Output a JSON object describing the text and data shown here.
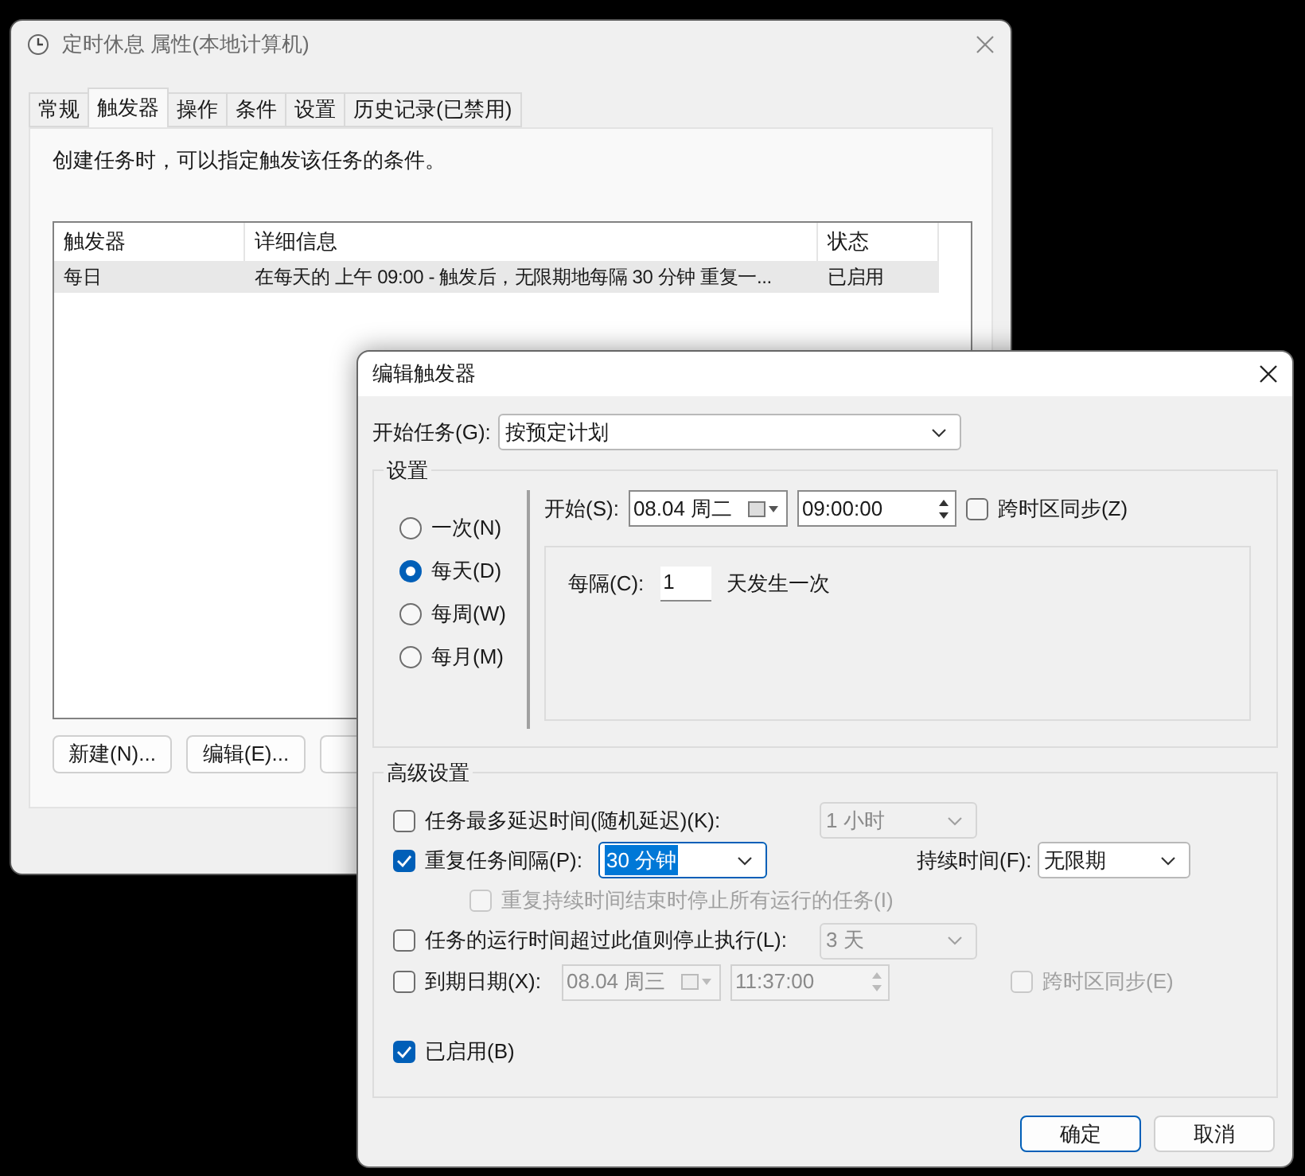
{
  "main_window": {
    "title": "定时休息 属性(本地计算机)",
    "tabs": [
      {
        "label": "常规",
        "selected": false
      },
      {
        "label": "触发器",
        "selected": true
      },
      {
        "label": "操作",
        "selected": false
      },
      {
        "label": "条件",
        "selected": false
      },
      {
        "label": "设置",
        "selected": false
      },
      {
        "label": "历史记录(已禁用)",
        "selected": false
      }
    ],
    "description": "创建任务时，可以指定触发该任务的条件。",
    "table": {
      "columns": [
        "触发器",
        "详细信息",
        "状态"
      ],
      "rows": [
        {
          "cells": [
            "每日",
            "在每天的 上午 09:00 - 触发后，无限期地每隔 30 分钟 重复一...",
            "已启用"
          ],
          "selected": true
        }
      ]
    },
    "buttons": [
      "新建(N)...",
      "编辑(E)..."
    ]
  },
  "dialog": {
    "title": "编辑触发器",
    "start_task": {
      "label": "开始任务(G):",
      "value": "按预定计划"
    },
    "settings": {
      "legend": "设置",
      "schedule_options": [
        {
          "label": "一次(N)",
          "selected": false
        },
        {
          "label": "每天(D)",
          "selected": true
        },
        {
          "label": "每周(W)",
          "selected": false
        },
        {
          "label": "每月(M)",
          "selected": false
        }
      ],
      "start": {
        "label": "开始(S):",
        "date": "08.04 周二",
        "time": "09:00:00",
        "sync_label": "跨时区同步(Z)",
        "sync_checked": false
      },
      "recur": {
        "label": "每隔(C):",
        "value": "1",
        "suffix": "天发生一次"
      }
    },
    "advanced": {
      "legend": "高级设置",
      "delay": {
        "label": "任务最多延迟时间(随机延迟)(K):",
        "checked": false,
        "value": "1 小时",
        "disabled": true
      },
      "repeat": {
        "label": "重复任务间隔(P):",
        "checked": true,
        "value": "30 分钟",
        "highlighted": true,
        "duration_label": "持续时间(F):",
        "duration_value": "无限期"
      },
      "stop_all": {
        "label": "重复持续时间结束时停止所有运行的任务(I)",
        "checked": false,
        "disabled": true
      },
      "stop_if_longer": {
        "label": "任务的运行时间超过此值则停止执行(L):",
        "checked": false,
        "value": "3 天",
        "disabled": true
      },
      "expire": {
        "label": "到期日期(X):",
        "checked": false,
        "date": "08.04 周三",
        "time": "11:37:00",
        "disabled": true,
        "sync_label": "跨时区同步(E)",
        "sync_checked": false
      },
      "enabled": {
        "label": "已启用(B)",
        "checked": true
      }
    },
    "buttons": [
      {
        "label": "确定",
        "selected": true
      },
      {
        "label": "取消",
        "selected": false
      }
    ]
  }
}
